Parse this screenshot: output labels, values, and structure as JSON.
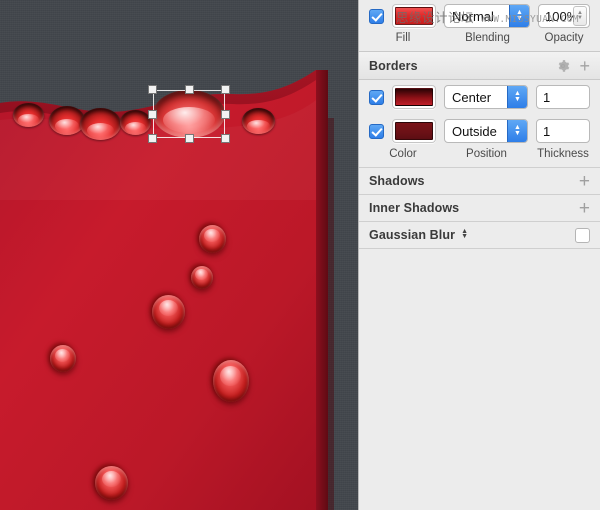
{
  "watermark": {
    "chinese": "思缘设计论坛",
    "url": "WWW.MISSYUAN.COM"
  },
  "canvas": {
    "name": "design-canvas",
    "background_color": "#42464c",
    "liquid_color": "#c3172a",
    "selected_shape_label": "selected-ellipse"
  },
  "panel": {
    "fill_section": {
      "checkbox_checked": true,
      "swatch_color": "#e0242c",
      "blending_value": "Normal",
      "opacity_value": "100%",
      "labels": {
        "fill": "Fill",
        "blending": "Blending",
        "opacity": "Opacity"
      }
    },
    "borders_section": {
      "title": "Borders",
      "gear_icon": "gear-icon",
      "plus_icon": "plus-icon",
      "rows": [
        {
          "checked": true,
          "swatch_color": "#8c1016",
          "position": "Center",
          "thickness": "1"
        },
        {
          "checked": true,
          "swatch_color": "#6e1216",
          "position": "Outside",
          "thickness": "1"
        }
      ],
      "labels": {
        "color": "Color",
        "position": "Position",
        "thickness": "Thickness"
      }
    },
    "shadows_section": {
      "title": "Shadows",
      "plus_icon": "plus-icon"
    },
    "inner_shadows_section": {
      "title": "Inner Shadows",
      "plus_icon": "plus-icon"
    },
    "gaussian_blur_section": {
      "title": "Gaussian Blur",
      "has_updown_stepper": true,
      "checkbox_checked": false
    }
  }
}
